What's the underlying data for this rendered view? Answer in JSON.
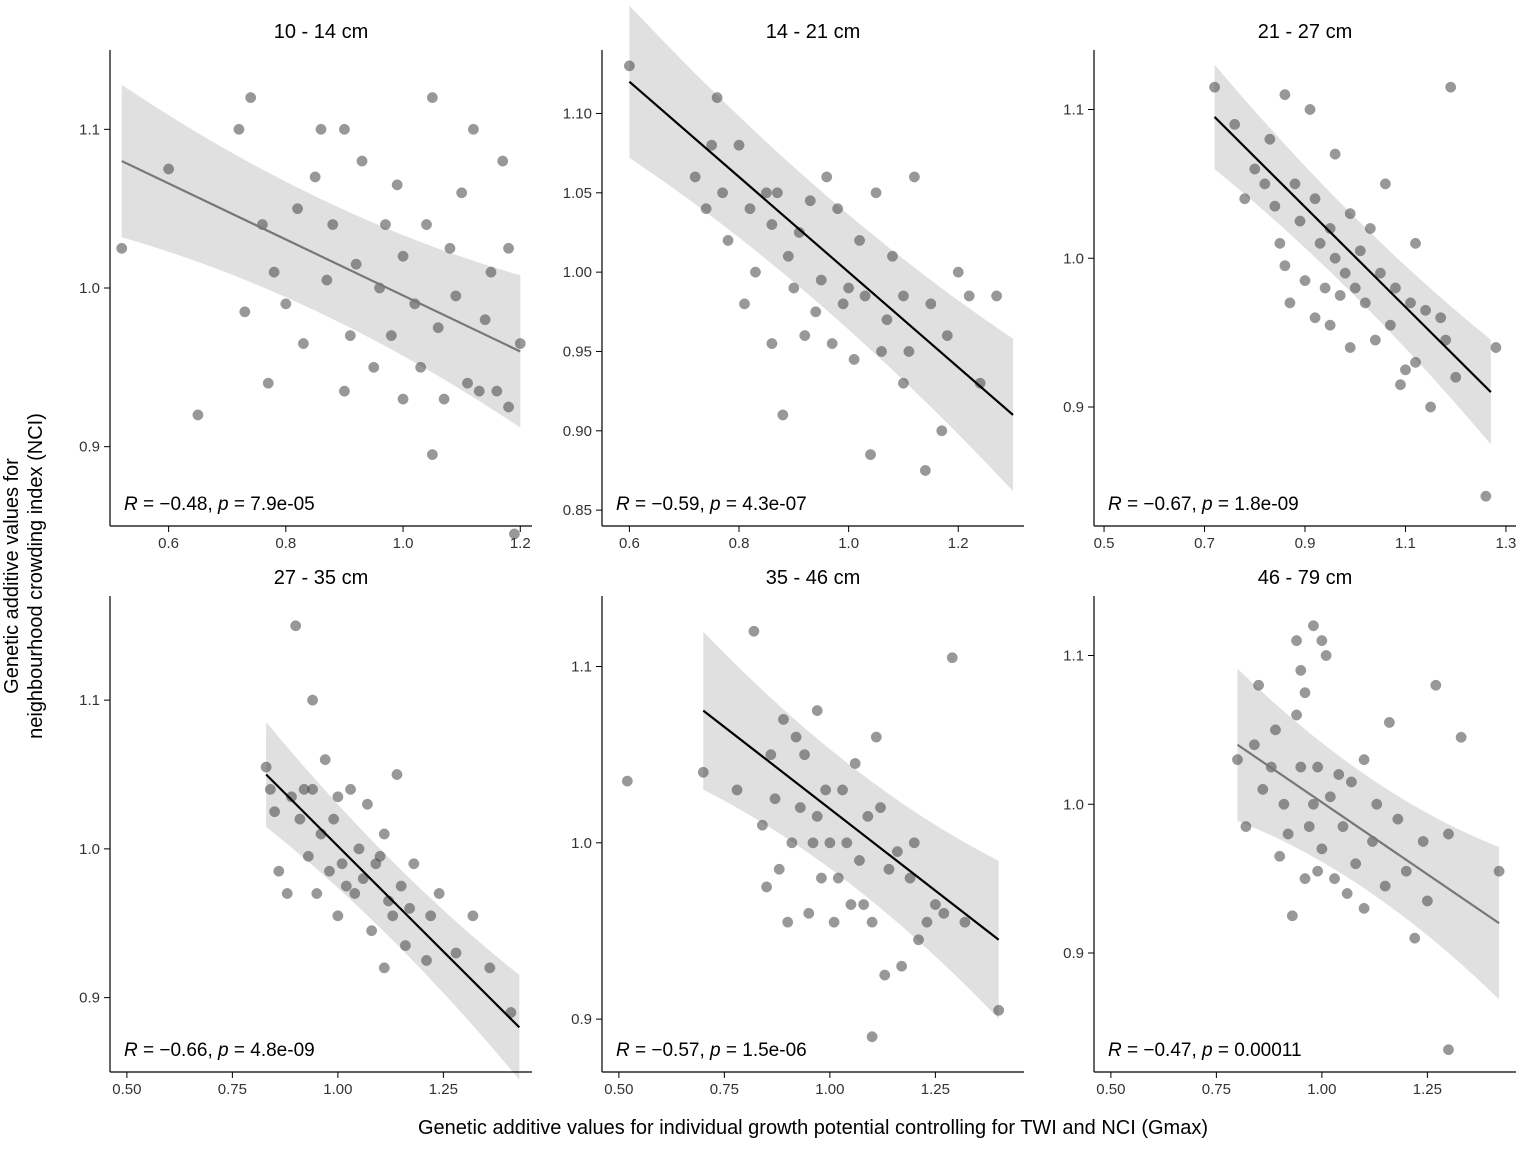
{
  "chart_data": [
    {
      "type": "scatter",
      "title": "10 - 14 cm",
      "xlim": [
        0.5,
        1.22
      ],
      "ylim": [
        0.85,
        1.15
      ],
      "xticks": [
        0.6,
        0.8,
        1.0,
        1.2
      ],
      "yticks": [
        0.9,
        1.0,
        1.1
      ],
      "ytick_labels": [
        "0.9",
        "1.0",
        "1.1"
      ],
      "reg": {
        "x0": 0.52,
        "y0": 1.08,
        "x1": 1.2,
        "y1": 0.96,
        "se": 0.03,
        "color": "grey"
      },
      "stat": {
        "R": -0.48,
        "p": "7.9e-05"
      },
      "points": [
        [
          0.52,
          1.025
        ],
        [
          0.6,
          1.075
        ],
        [
          0.65,
          0.92
        ],
        [
          0.72,
          1.1
        ],
        [
          0.73,
          0.985
        ],
        [
          0.74,
          1.12
        ],
        [
          0.76,
          1.04
        ],
        [
          0.77,
          0.94
        ],
        [
          0.78,
          1.01
        ],
        [
          0.8,
          0.99
        ],
        [
          0.82,
          1.05
        ],
        [
          0.83,
          0.965
        ],
        [
          0.85,
          1.07
        ],
        [
          0.86,
          1.1
        ],
        [
          0.87,
          1.005
        ],
        [
          0.88,
          1.04
        ],
        [
          0.9,
          0.935
        ],
        [
          0.9,
          1.1
        ],
        [
          0.91,
          0.97
        ],
        [
          0.92,
          1.015
        ],
        [
          0.93,
          1.08
        ],
        [
          0.95,
          0.95
        ],
        [
          0.96,
          1.0
        ],
        [
          0.97,
          1.04
        ],
        [
          0.98,
          0.97
        ],
        [
          0.99,
          1.065
        ],
        [
          1.0,
          0.93
        ],
        [
          1.0,
          1.02
        ],
        [
          1.02,
          0.99
        ],
        [
          1.03,
          0.95
        ],
        [
          1.04,
          1.04
        ],
        [
          1.05,
          0.895
        ],
        [
          1.05,
          1.12
        ],
        [
          1.06,
          0.975
        ],
        [
          1.07,
          0.93
        ],
        [
          1.08,
          1.025
        ],
        [
          1.09,
          0.995
        ],
        [
          1.1,
          1.06
        ],
        [
          1.11,
          0.94
        ],
        [
          1.12,
          1.1
        ],
        [
          1.13,
          0.935
        ],
        [
          1.14,
          0.98
        ],
        [
          1.15,
          1.01
        ],
        [
          1.16,
          0.935
        ],
        [
          1.17,
          1.08
        ],
        [
          1.18,
          0.925
        ],
        [
          1.18,
          1.025
        ],
        [
          1.19,
          0.845
        ],
        [
          1.2,
          0.965
        ]
      ]
    },
    {
      "type": "scatter",
      "title": "14 - 21 cm",
      "xlim": [
        0.55,
        1.32
      ],
      "ylim": [
        0.84,
        1.14
      ],
      "xticks": [
        0.6,
        0.8,
        1.0,
        1.2
      ],
      "yticks": [
        0.85,
        0.9,
        0.95,
        1.0,
        1.05,
        1.1
      ],
      "ytick_labels": [
        "0.85",
        "0.90",
        "0.95",
        "1.00",
        "1.05",
        "1.10"
      ],
      "reg": {
        "x0": 0.6,
        "y0": 1.12,
        "x1": 1.3,
        "y1": 0.91,
        "se": 0.03,
        "color": "black"
      },
      "stat": {
        "R": -0.59,
        "p": "4.3e-07"
      },
      "points": [
        [
          0.6,
          1.13
        ],
        [
          0.72,
          1.06
        ],
        [
          0.74,
          1.04
        ],
        [
          0.75,
          1.08
        ],
        [
          0.76,
          1.11
        ],
        [
          0.77,
          1.05
        ],
        [
          0.78,
          1.02
        ],
        [
          0.8,
          1.08
        ],
        [
          0.81,
          0.98
        ],
        [
          0.82,
          1.04
        ],
        [
          0.83,
          1.0
        ],
        [
          0.85,
          1.05
        ],
        [
          0.86,
          1.03
        ],
        [
          0.86,
          0.955
        ],
        [
          0.87,
          1.05
        ],
        [
          0.88,
          0.91
        ],
        [
          0.89,
          1.01
        ],
        [
          0.9,
          0.99
        ],
        [
          0.91,
          1.025
        ],
        [
          0.92,
          0.96
        ],
        [
          0.93,
          1.045
        ],
        [
          0.94,
          0.975
        ],
        [
          0.95,
          0.995
        ],
        [
          0.96,
          1.06
        ],
        [
          0.97,
          0.955
        ],
        [
          0.98,
          1.04
        ],
        [
          0.99,
          0.98
        ],
        [
          1.0,
          0.99
        ],
        [
          1.01,
          0.945
        ],
        [
          1.02,
          1.02
        ],
        [
          1.03,
          0.985
        ],
        [
          1.04,
          0.885
        ],
        [
          1.05,
          1.05
        ],
        [
          1.06,
          0.95
        ],
        [
          1.07,
          0.97
        ],
        [
          1.08,
          1.01
        ],
        [
          1.1,
          0.93
        ],
        [
          1.1,
          0.985
        ],
        [
          1.11,
          0.95
        ],
        [
          1.12,
          1.06
        ],
        [
          1.14,
          0.875
        ],
        [
          1.15,
          0.98
        ],
        [
          1.17,
          0.9
        ],
        [
          1.18,
          0.96
        ],
        [
          1.2,
          1.0
        ],
        [
          1.22,
          0.985
        ],
        [
          1.24,
          0.93
        ],
        [
          1.27,
          0.985
        ]
      ]
    },
    {
      "type": "scatter",
      "title": "21 - 27 cm",
      "xlim": [
        0.48,
        1.32
      ],
      "ylim": [
        0.82,
        1.14
      ],
      "xticks": [
        0.5,
        0.7,
        0.9,
        1.1,
        1.3
      ],
      "yticks": [
        0.9,
        1.0,
        1.1
      ],
      "ytick_labels": [
        "0.9",
        "1.0",
        "1.1"
      ],
      "reg": {
        "x0": 0.72,
        "y0": 1.095,
        "x1": 1.27,
        "y1": 0.91,
        "se": 0.022,
        "color": "black"
      },
      "stat": {
        "R": -0.67,
        "p": "1.8e-09"
      },
      "points": [
        [
          0.72,
          1.115
        ],
        [
          0.76,
          1.09
        ],
        [
          0.78,
          1.04
        ],
        [
          0.8,
          1.06
        ],
        [
          0.82,
          1.05
        ],
        [
          0.83,
          1.08
        ],
        [
          0.84,
          1.035
        ],
        [
          0.85,
          1.01
        ],
        [
          0.86,
          1.11
        ],
        [
          0.86,
          0.995
        ],
        [
          0.87,
          0.97
        ],
        [
          0.88,
          1.05
        ],
        [
          0.89,
          1.025
        ],
        [
          0.9,
          0.985
        ],
        [
          0.91,
          1.1
        ],
        [
          0.92,
          0.96
        ],
        [
          0.92,
          1.04
        ],
        [
          0.93,
          1.01
        ],
        [
          0.94,
          0.98
        ],
        [
          0.95,
          1.02
        ],
        [
          0.95,
          0.955
        ],
        [
          0.96,
          1.0
        ],
        [
          0.96,
          1.07
        ],
        [
          0.97,
          0.975
        ],
        [
          0.98,
          0.99
        ],
        [
          0.99,
          1.03
        ],
        [
          0.99,
          0.94
        ],
        [
          1.0,
          0.98
        ],
        [
          1.01,
          1.005
        ],
        [
          1.02,
          0.97
        ],
        [
          1.03,
          1.02
        ],
        [
          1.04,
          0.945
        ],
        [
          1.05,
          0.99
        ],
        [
          1.06,
          1.05
        ],
        [
          1.07,
          0.955
        ],
        [
          1.08,
          0.98
        ],
        [
          1.09,
          0.915
        ],
        [
          1.1,
          0.925
        ],
        [
          1.11,
          0.97
        ],
        [
          1.12,
          1.01
        ],
        [
          1.12,
          0.93
        ],
        [
          1.14,
          0.965
        ],
        [
          1.15,
          0.9
        ],
        [
          1.17,
          0.96
        ],
        [
          1.18,
          0.945
        ],
        [
          1.19,
          1.115
        ],
        [
          1.2,
          0.92
        ],
        [
          1.26,
          0.84
        ],
        [
          1.28,
          0.94
        ]
      ]
    },
    {
      "type": "scatter",
      "title": "27 - 35 cm",
      "xlim": [
        0.46,
        1.46
      ],
      "ylim": [
        0.85,
        1.17
      ],
      "xticks": [
        0.5,
        0.75,
        1.0,
        1.25
      ],
      "yticks": [
        0.9,
        1.0,
        1.1
      ],
      "ytick_labels": [
        "0.9",
        "1.0",
        "1.1"
      ],
      "reg": {
        "x0": 0.83,
        "y0": 1.05,
        "x1": 1.43,
        "y1": 0.88,
        "se": 0.022,
        "color": "black"
      },
      "stat": {
        "R": -0.66,
        "p": "4.8e-09"
      },
      "points": [
        [
          0.83,
          1.055
        ],
        [
          0.84,
          1.04
        ],
        [
          0.85,
          1.025
        ],
        [
          0.86,
          0.985
        ],
        [
          0.88,
          0.97
        ],
        [
          0.89,
          1.035
        ],
        [
          0.9,
          1.15
        ],
        [
          0.91,
          1.02
        ],
        [
          0.92,
          1.04
        ],
        [
          0.93,
          0.995
        ],
        [
          0.94,
          1.1
        ],
        [
          0.94,
          1.04
        ],
        [
          0.95,
          0.97
        ],
        [
          0.96,
          1.01
        ],
        [
          0.97,
          1.06
        ],
        [
          0.98,
          0.985
        ],
        [
          0.99,
          1.02
        ],
        [
          1.0,
          0.955
        ],
        [
          1.0,
          1.035
        ],
        [
          1.01,
          0.99
        ],
        [
          1.02,
          0.975
        ],
        [
          1.03,
          1.04
        ],
        [
          1.04,
          0.97
        ],
        [
          1.05,
          1.0
        ],
        [
          1.06,
          0.98
        ],
        [
          1.07,
          1.03
        ],
        [
          1.08,
          0.945
        ],
        [
          1.09,
          0.99
        ],
        [
          1.1,
          0.995
        ],
        [
          1.11,
          1.01
        ],
        [
          1.11,
          0.92
        ],
        [
          1.12,
          0.965
        ],
        [
          1.13,
          0.955
        ],
        [
          1.14,
          1.05
        ],
        [
          1.15,
          0.975
        ],
        [
          1.16,
          0.935
        ],
        [
          1.17,
          0.96
        ],
        [
          1.18,
          0.99
        ],
        [
          1.21,
          0.925
        ],
        [
          1.22,
          0.955
        ],
        [
          1.24,
          0.97
        ],
        [
          1.28,
          0.93
        ],
        [
          1.32,
          0.955
        ],
        [
          1.36,
          0.92
        ],
        [
          1.41,
          0.89
        ]
      ]
    },
    {
      "type": "scatter",
      "title": "35 - 46 cm",
      "xlim": [
        0.46,
        1.46
      ],
      "ylim": [
        0.87,
        1.14
      ],
      "xticks": [
        0.5,
        0.75,
        1.0,
        1.25
      ],
      "yticks": [
        0.9,
        1.0,
        1.1
      ],
      "ytick_labels": [
        "0.9",
        "1.0",
        "1.1"
      ],
      "reg": {
        "x0": 0.7,
        "y0": 1.075,
        "x1": 1.4,
        "y1": 0.945,
        "se": 0.028,
        "color": "black"
      },
      "stat": {
        "R": -0.57,
        "p": "1.5e-06"
      },
      "points": [
        [
          0.52,
          1.035
        ],
        [
          0.7,
          1.04
        ],
        [
          0.78,
          1.03
        ],
        [
          0.82,
          1.12
        ],
        [
          0.84,
          1.01
        ],
        [
          0.85,
          0.975
        ],
        [
          0.86,
          1.05
        ],
        [
          0.87,
          1.025
        ],
        [
          0.88,
          0.985
        ],
        [
          0.89,
          1.07
        ],
        [
          0.9,
          0.955
        ],
        [
          0.91,
          1.0
        ],
        [
          0.92,
          1.06
        ],
        [
          0.93,
          1.02
        ],
        [
          0.94,
          1.05
        ],
        [
          0.95,
          0.96
        ],
        [
          0.96,
          1.0
        ],
        [
          0.97,
          1.015
        ],
        [
          0.97,
          1.075
        ],
        [
          0.98,
          0.98
        ],
        [
          0.99,
          1.03
        ],
        [
          1.0,
          1.0
        ],
        [
          1.01,
          0.955
        ],
        [
          1.02,
          0.98
        ],
        [
          1.03,
          1.03
        ],
        [
          1.04,
          1.0
        ],
        [
          1.05,
          0.965
        ],
        [
          1.06,
          1.045
        ],
        [
          1.07,
          0.99
        ],
        [
          1.08,
          0.965
        ],
        [
          1.09,
          1.015
        ],
        [
          1.1,
          0.89
        ],
        [
          1.1,
          0.955
        ],
        [
          1.11,
          1.06
        ],
        [
          1.12,
          1.02
        ],
        [
          1.13,
          0.925
        ],
        [
          1.14,
          0.985
        ],
        [
          1.16,
          0.995
        ],
        [
          1.17,
          0.93
        ],
        [
          1.19,
          0.98
        ],
        [
          1.2,
          1.0
        ],
        [
          1.21,
          0.945
        ],
        [
          1.23,
          0.955
        ],
        [
          1.25,
          0.965
        ],
        [
          1.27,
          0.96
        ],
        [
          1.29,
          1.105
        ],
        [
          1.32,
          0.955
        ],
        [
          1.4,
          0.905
        ]
      ]
    },
    {
      "type": "scatter",
      "title": "46 - 79 cm",
      "xlim": [
        0.46,
        1.46
      ],
      "ylim": [
        0.82,
        1.14
      ],
      "xticks": [
        0.5,
        0.75,
        1.0,
        1.25
      ],
      "yticks": [
        0.9,
        1.0,
        1.1
      ],
      "ytick_labels": [
        "0.9",
        "1.0",
        "1.1"
      ],
      "reg": {
        "x0": 0.8,
        "y0": 1.04,
        "x1": 1.42,
        "y1": 0.92,
        "se": 0.032,
        "color": "grey"
      },
      "stat": {
        "R": -0.47,
        "p": "0.00011"
      },
      "points": [
        [
          0.8,
          1.03
        ],
        [
          0.82,
          0.985
        ],
        [
          0.84,
          1.04
        ],
        [
          0.85,
          1.08
        ],
        [
          0.86,
          1.01
        ],
        [
          0.88,
          1.025
        ],
        [
          0.89,
          1.05
        ],
        [
          0.9,
          0.965
        ],
        [
          0.91,
          1.0
        ],
        [
          0.92,
          0.98
        ],
        [
          0.93,
          0.925
        ],
        [
          0.94,
          1.06
        ],
        [
          0.94,
          1.11
        ],
        [
          0.95,
          1.025
        ],
        [
          0.95,
          1.09
        ],
        [
          0.96,
          1.075
        ],
        [
          0.96,
          0.95
        ],
        [
          0.97,
          0.985
        ],
        [
          0.98,
          1.12
        ],
        [
          0.98,
          1.0
        ],
        [
          0.99,
          1.025
        ],
        [
          0.99,
          0.955
        ],
        [
          1.0,
          1.11
        ],
        [
          1.0,
          0.97
        ],
        [
          1.01,
          1.1
        ],
        [
          1.02,
          1.005
        ],
        [
          1.03,
          0.95
        ],
        [
          1.04,
          1.02
        ],
        [
          1.05,
          0.985
        ],
        [
          1.06,
          0.94
        ],
        [
          1.07,
          1.015
        ],
        [
          1.08,
          0.96
        ],
        [
          1.1,
          1.03
        ],
        [
          1.1,
          0.93
        ],
        [
          1.12,
          0.975
        ],
        [
          1.13,
          1.0
        ],
        [
          1.15,
          0.945
        ],
        [
          1.16,
          1.055
        ],
        [
          1.18,
          0.99
        ],
        [
          1.2,
          0.955
        ],
        [
          1.22,
          0.91
        ],
        [
          1.24,
          0.975
        ],
        [
          1.25,
          0.935
        ],
        [
          1.27,
          1.08
        ],
        [
          1.3,
          0.835
        ],
        [
          1.3,
          0.98
        ],
        [
          1.33,
          1.045
        ],
        [
          1.42,
          0.955
        ]
      ]
    }
  ],
  "xlabel": "Genetic additive values for individual growth potential controlling for TWI and NCI (Gmax)",
  "ylabel_l1": "Genetic additive values for",
  "ylabel_l2": "neighbourhood crowding index (NCI)"
}
